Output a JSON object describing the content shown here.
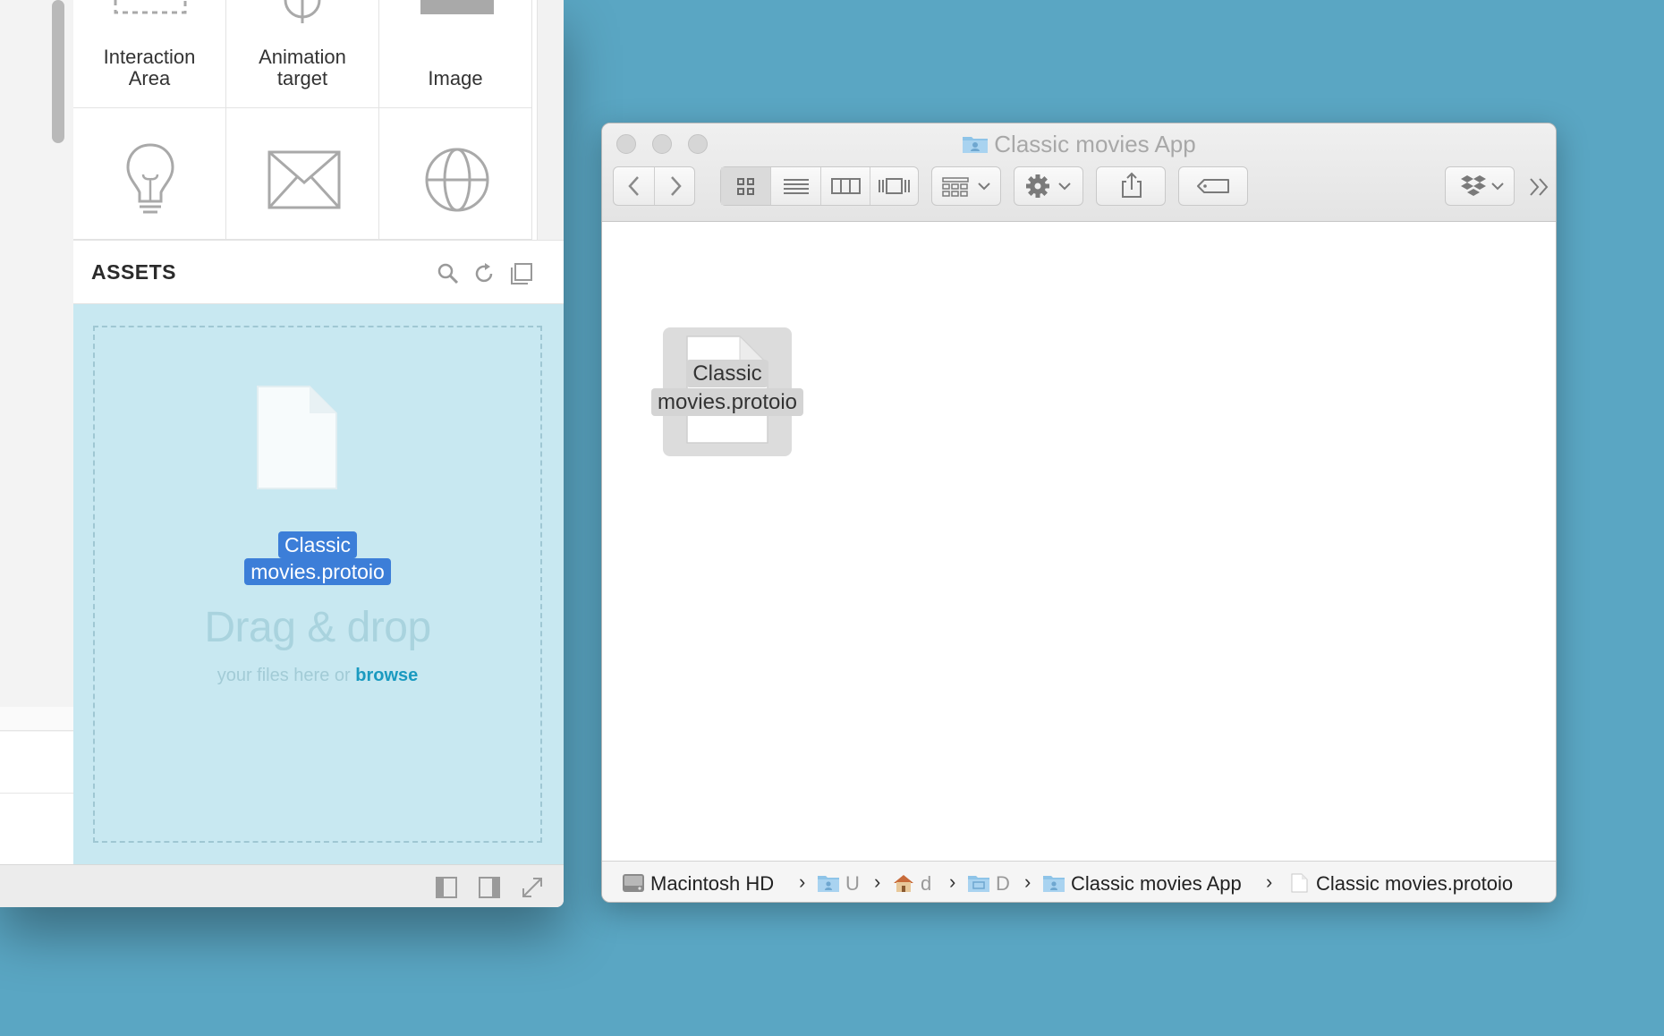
{
  "left_panel": {
    "components": [
      {
        "label_lines": [
          "Interaction",
          "Area"
        ],
        "icon": "interaction-area-icon"
      },
      {
        "label_lines": [
          "Animation",
          "target"
        ],
        "icon": "animation-target-icon"
      },
      {
        "label_lines": [
          "Image"
        ],
        "icon": "image-icon"
      },
      {
        "label_lines": [],
        "icon": "lightbulb-icon"
      },
      {
        "label_lines": [],
        "icon": "envelope-icon"
      },
      {
        "label_lines": [],
        "icon": "globe-icon"
      }
    ],
    "assets": {
      "title": "ASSETS",
      "icons": [
        "search-icon",
        "refresh-icon",
        "duplicate-icon"
      ]
    },
    "dropzone": {
      "file_name_lines": [
        "Classic",
        "movies.protoio"
      ],
      "title": "Drag & drop",
      "subtitle": "your files here or",
      "browse": "browse"
    },
    "footer_icons": [
      "left-panel-icon",
      "right-panel-icon",
      "expand-icon"
    ],
    "colors": {
      "dropzone_bg": "#c8e8f1",
      "selection_blue": "#3c7ed8",
      "browse_link": "#1a9ac0"
    }
  },
  "finder": {
    "title": "Classic movies App",
    "file": {
      "name_lines": [
        "Classic",
        "movies.protoio"
      ]
    },
    "toolbar": {
      "nav": [
        "back-icon",
        "forward-icon"
      ],
      "view_modes": [
        "icon-view-icon",
        "list-view-icon",
        "column-view-icon",
        "cover-flow-icon"
      ],
      "active_view": "icon-view-icon",
      "other": [
        "arrange-icon",
        "action-gear-icon",
        "share-icon",
        "tag-icon",
        "dropbox-icon",
        "overflow-icon"
      ]
    },
    "pathbar": [
      {
        "label": "Macintosh HD",
        "icon": "hard-drive-icon"
      },
      {
        "label": "U",
        "icon": "users-folder-icon"
      },
      {
        "label": "d",
        "icon": "home-icon"
      },
      {
        "label": "D",
        "icon": "desktop-folder-icon"
      },
      {
        "label": "Classic movies App",
        "icon": "folder-icon"
      },
      {
        "label": "Classic movies.protoio",
        "icon": "document-icon"
      }
    ],
    "separator": "›"
  }
}
